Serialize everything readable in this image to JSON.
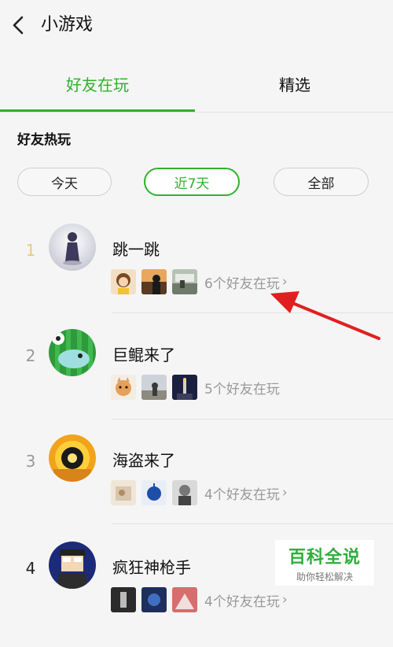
{
  "header": {
    "title": "小游戏"
  },
  "tabs": [
    {
      "label": "好友在玩"
    },
    {
      "label": "精选"
    }
  ],
  "section_title": "好友热玩",
  "filters": [
    {
      "label": "今天"
    },
    {
      "label": "近7天"
    },
    {
      "label": "全部"
    }
  ],
  "games": [
    {
      "rank": "1",
      "name": "跳一跳",
      "friends_text": "6个好友在玩"
    },
    {
      "rank": "2",
      "name": "巨鲲来了",
      "friends_text": "5个好友在玩"
    },
    {
      "rank": "3",
      "name": "海盗来了",
      "friends_text": "4个好友在玩"
    },
    {
      "rank": "4",
      "name": "疯狂神枪手",
      "friends_text": "4个好友在玩"
    }
  ],
  "watermark": {
    "main": "百科全说",
    "sub": "助你轻松解决"
  },
  "colors": {
    "accent_green": "#2fb12f",
    "annotation_red": "#e02020"
  }
}
